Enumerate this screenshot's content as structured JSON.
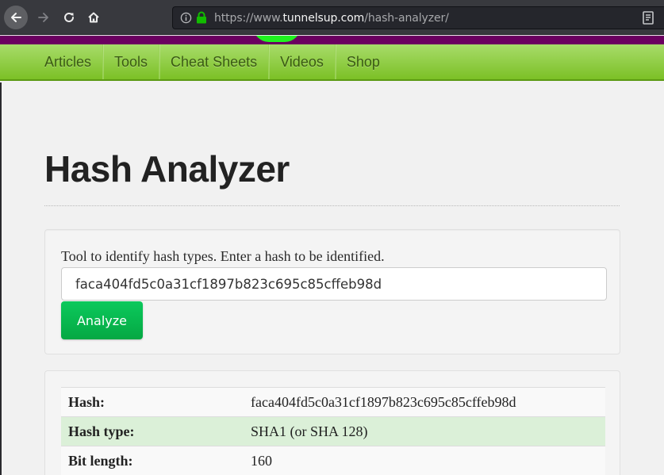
{
  "browser": {
    "url_scheme": "https://www.",
    "url_host": "tunnelsup.com",
    "url_path": "/hash-analyzer/",
    "icons": [
      "back-arrow-icon",
      "forward-arrow-icon",
      "reload-icon",
      "home-icon",
      "info-icon",
      "lock-icon",
      "reader-view-icon"
    ],
    "colors": {
      "lock": "#12bc00"
    }
  },
  "site": {
    "colors": {
      "top_bar": "#6b0060",
      "nav": "#8cc63f",
      "logo": "#1ff21f"
    },
    "nav": [
      {
        "label": "Articles"
      },
      {
        "label": "Tools"
      },
      {
        "label": "Cheat Sheets"
      },
      {
        "label": "Videos"
      },
      {
        "label": "Shop"
      }
    ]
  },
  "page": {
    "title": "Hash Analyzer",
    "form": {
      "label": "Tool to identify hash types. Enter a hash to be identified.",
      "input_value": "faca404fd5c0a31cf1897b823c695c85cffeb98d",
      "button_label": "Analyze",
      "button_color": "#08b850"
    },
    "results": [
      {
        "key": "Hash:",
        "value": "faca404fd5c0a31cf1897b823c695c85cffeb98d"
      },
      {
        "key": "Hash type:",
        "value": "SHA1 (or SHA 128)"
      },
      {
        "key": "Bit length:",
        "value": "160"
      }
    ]
  }
}
